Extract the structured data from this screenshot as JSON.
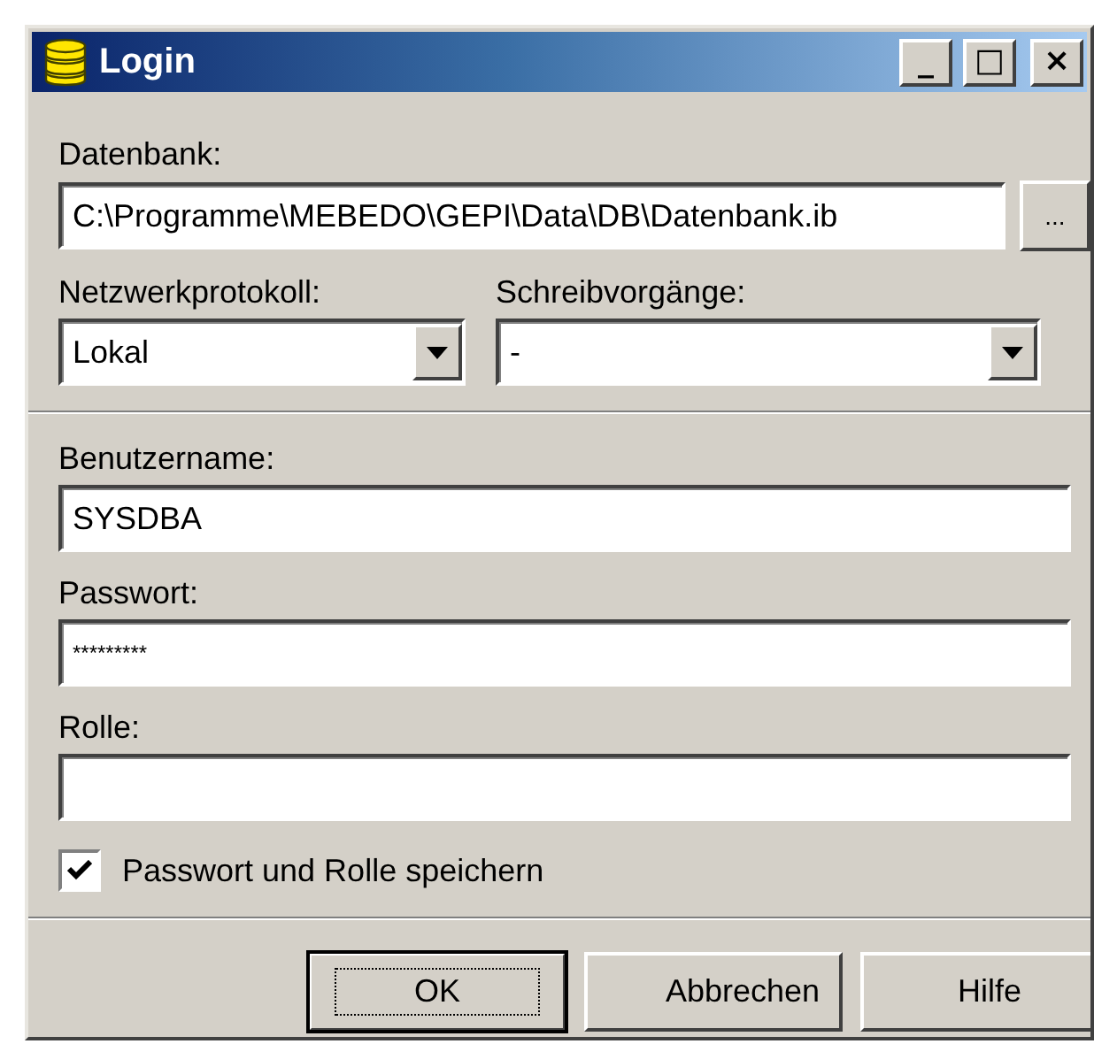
{
  "window": {
    "title": "Login",
    "controls": [
      "_",
      "□",
      "×"
    ]
  },
  "database": {
    "label": "Datenbank:",
    "value": "C:\\Programme\\MEBEDO\\GEPI\\Data\\DB\\Datenbank.ib",
    "browse": "..."
  },
  "protocol": {
    "label": "Netzwerkprotokoll:",
    "value": "Lokal"
  },
  "writes": {
    "label": "Schreibvorgänge:",
    "value": "-"
  },
  "fields": [
    {
      "label": "Benutzername:",
      "value": "SYSDBA"
    },
    {
      "label": "Passwort:",
      "value": "*********"
    },
    {
      "label": "Rolle:"
    }
  ],
  "save": {
    "label": "Passwort und Rolle speichern",
    "checked": true
  },
  "buttons": [
    {
      "label": "OK",
      "default": true
    },
    {
      "label": "Abbrechen",
      "default": false
    },
    {
      "label": "Hilfe",
      "default": false
    }
  ]
}
